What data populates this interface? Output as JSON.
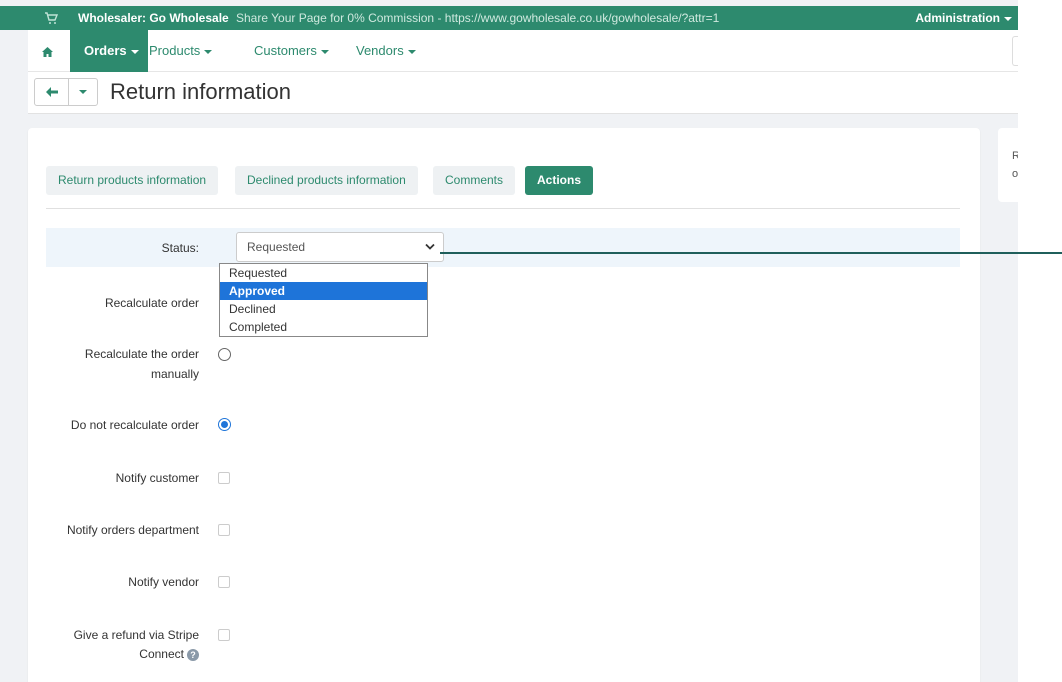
{
  "topbar": {
    "store_name": "Wholesaler: Go Wholesale",
    "promo": "Share Your Page for 0% Commission - https://www.gowholesale.co.uk/gowholesale/?attr=1",
    "admin_label": "Administration"
  },
  "nav": {
    "items": [
      {
        "label": "Orders",
        "active": true
      },
      {
        "label": "Products",
        "active": false
      },
      {
        "label": "Customers",
        "active": false
      },
      {
        "label": "Vendors",
        "active": false
      }
    ]
  },
  "page": {
    "title": "Return information"
  },
  "side_card": {
    "line1": "R",
    "line2": "o"
  },
  "tabs": [
    {
      "label": "Return products information",
      "active": false
    },
    {
      "label": "Declined products information",
      "active": false
    },
    {
      "label": "Comments",
      "active": false
    },
    {
      "label": "Actions",
      "active": true
    }
  ],
  "status": {
    "label": "Status:",
    "value": "Requested",
    "options": [
      "Requested",
      "Approved",
      "Declined",
      "Completed"
    ],
    "highlighted": "Approved"
  },
  "fields": {
    "recalculate_order": "Recalculate order",
    "recalculate_manually_1": "Recalculate the order",
    "recalculate_manually_2": "manually",
    "do_not_recalculate": "Do not recalculate order",
    "notify_customer": "Notify customer",
    "notify_orders_department": "Notify orders department",
    "notify_vendor": "Notify vendor",
    "stripe_refund_1": "Give a refund via Stripe",
    "stripe_refund_2": "Connect"
  },
  "icons": {
    "cart": "cart-icon",
    "home": "home-icon",
    "back": "arrow-left-icon",
    "help": "question-circle-icon"
  },
  "colors": {
    "brand": "#2d8a6e",
    "selected_option": "#1e74d9",
    "connector": "#1f5f5b"
  }
}
